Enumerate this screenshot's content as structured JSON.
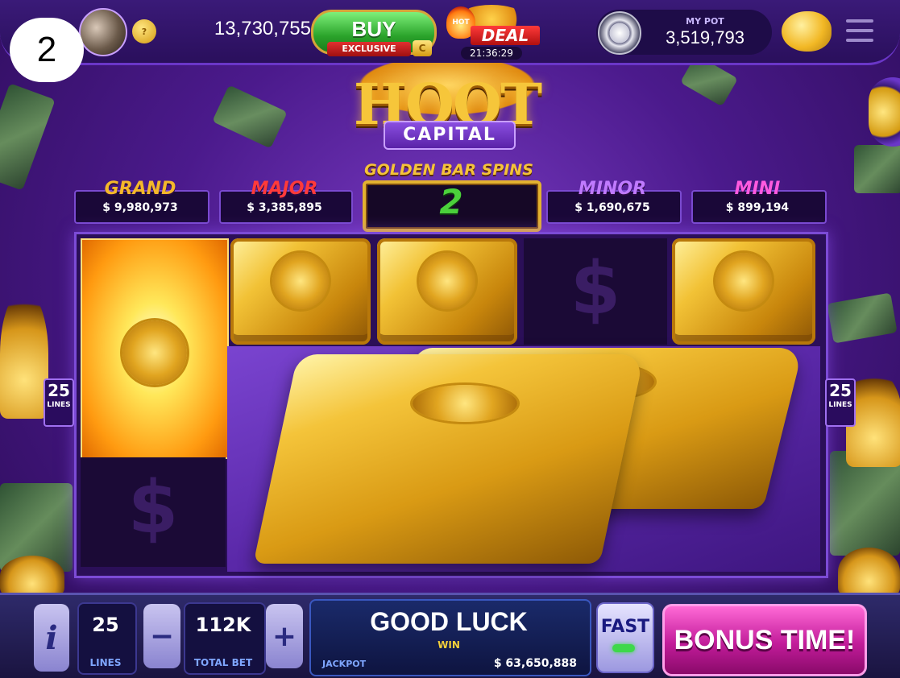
{
  "step_badge": "2",
  "top_bar": {
    "level_badge": "?",
    "balance": "13,730,755",
    "buy_label": "BUY",
    "exclusive_label": "EXCLUSIVE",
    "deal_label": "DEAL",
    "deal_hot": "HOT",
    "deal_timer": "21:36:29",
    "pot_title": "MY POT",
    "pot_value": "3,519,793"
  },
  "game": {
    "logo_title": "HOOT",
    "logo_subtitle": "CAPITAL"
  },
  "jackpots": [
    {
      "name": "GRAND",
      "value": "$ 9,980,973",
      "color": "#f4b82a"
    },
    {
      "name": "MAJOR",
      "value": "$ 3,385,895",
      "color": "#ff3a3a"
    },
    {
      "name": "MINOR",
      "value": "$ 1,690,675",
      "color": "#c07aff"
    },
    {
      "name": "MINI",
      "value": "$ 899,194",
      "color": "#ff5ae0"
    }
  ],
  "golden_bar_spins": {
    "title": "GOLDEN BAR SPINS",
    "count": "2"
  },
  "reels": {
    "lines_left": "25",
    "lines_right": "25",
    "lines_label": "LINES",
    "dollar_symbol": "$"
  },
  "bottom_bar": {
    "info_label": "i",
    "lines_value": "25",
    "lines_label": "LINES",
    "minus_label": "−",
    "total_bet_value": "112K",
    "total_bet_label": "TOTAL BET",
    "plus_label": "+",
    "message": "GOOD LUCK",
    "win_label": "WIN",
    "jackpot_label": "JACKPOT",
    "jackpot_value": "$ 63,650,888",
    "fast_label": "FAST",
    "bonus_label": "BONUS TIME!"
  },
  "icons": [
    "avatar",
    "level-coin-icon",
    "vault-icon",
    "piggy-bank-icon",
    "menu-icon",
    "owl-emblem-icon",
    "dollar-icon"
  ]
}
